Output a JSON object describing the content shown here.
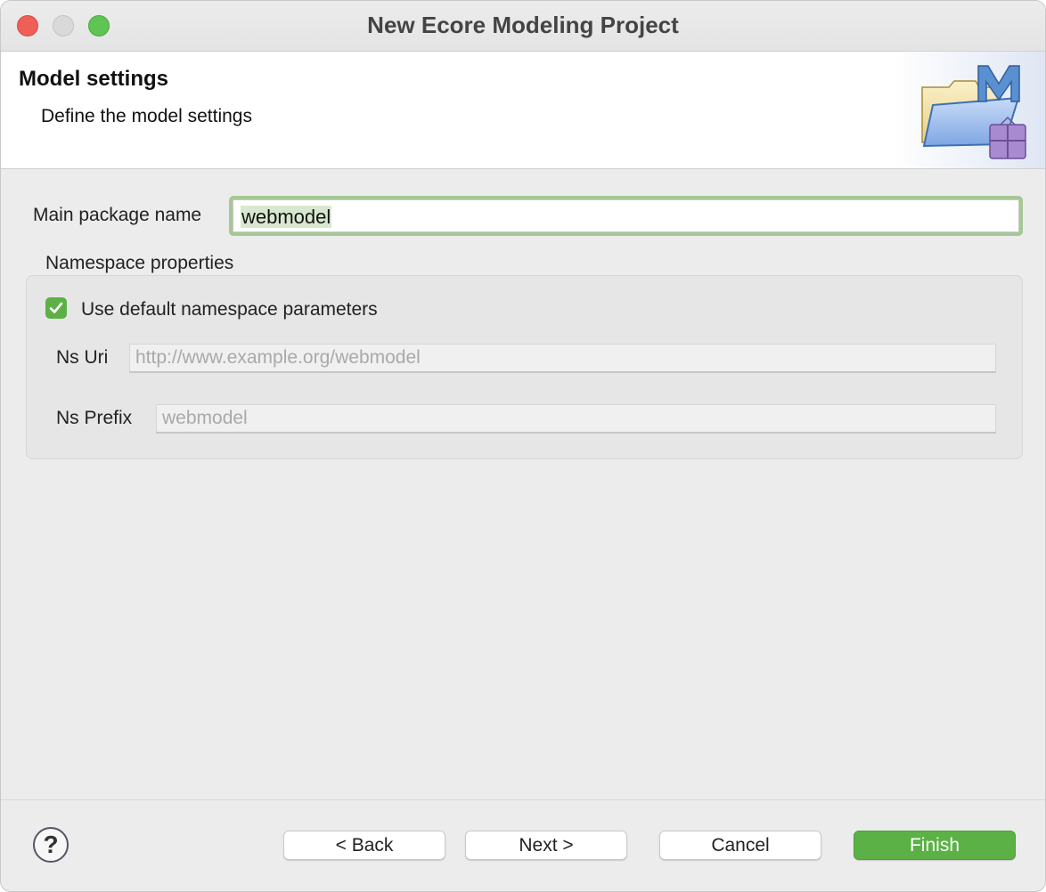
{
  "window": {
    "title": "New Ecore Modeling Project"
  },
  "banner": {
    "title": "Model settings",
    "description": "Define the model settings",
    "icon": "ecore-project-wizard-icon"
  },
  "form": {
    "main_package_label": "Main package name",
    "main_package_value": "webmodel",
    "namespace_group_label": "Namespace properties",
    "use_default_label": "Use default namespace parameters",
    "use_default_checked": true,
    "ns_uri_label": "Ns Uri",
    "ns_uri_value": "http://www.example.org/webmodel",
    "ns_prefix_label": "Ns Prefix",
    "ns_prefix_value": "webmodel"
  },
  "footer": {
    "help_icon": "question-mark",
    "back_label": "< Back",
    "next_label": "Next >",
    "cancel_label": "Cancel",
    "finish_label": "Finish"
  },
  "colors": {
    "accent_green": "#5bb145",
    "focus_ring": "#a6c894",
    "close": "#ee5f57",
    "maximize": "#5fc454"
  }
}
